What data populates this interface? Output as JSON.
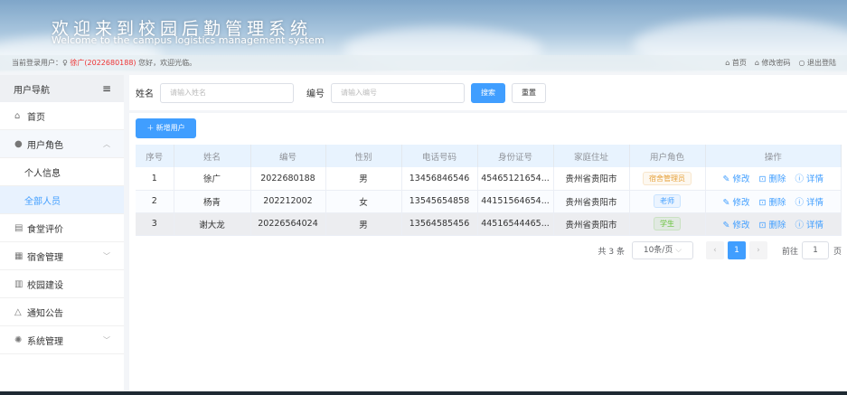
{
  "header": {
    "title_cn": "欢迎来到校园后勤管理系统",
    "title_en": "Welcome to the campus logistics management system",
    "login_prefix": "当前登录用户：",
    "user": "徐广(2022680188)",
    "greeting": "您好，欢迎光临。",
    "links": [
      {
        "icon": "home-icon",
        "label": "首页"
      },
      {
        "icon": "lock-icon",
        "label": "修改密码"
      },
      {
        "icon": "power-icon",
        "label": "退出登陆"
      }
    ]
  },
  "sidebar": {
    "title": "用户导航",
    "items": [
      {
        "icon": "home-icon",
        "label": "首页"
      },
      {
        "icon": "user-icon",
        "label": "用户角色",
        "expanded": true
      },
      {
        "label": "个人信息",
        "sub": true
      },
      {
        "label": "全部人员",
        "sub": true,
        "active": true
      },
      {
        "icon": "document-icon",
        "label": "食堂评价"
      },
      {
        "icon": "building-icon",
        "label": "宿舍管理",
        "has_children": true
      },
      {
        "icon": "office-icon",
        "label": "校园建设"
      },
      {
        "icon": "bell-icon",
        "label": "通知公告"
      },
      {
        "icon": "gear-icon",
        "label": "系统管理",
        "has_children": true
      }
    ]
  },
  "search": {
    "name_label": "姓名",
    "name_placeholder": "请输入姓名",
    "id_label": "编号",
    "id_placeholder": "请输入编号",
    "search_btn": "搜索",
    "reset_btn": "重置"
  },
  "add_btn": "＋ 新增用户",
  "table": {
    "headers": [
      "序号",
      "姓名",
      "编号",
      "性别",
      "电话号码",
      "身份证号",
      "家庭住址",
      "用户角色",
      "操作"
    ],
    "rows": [
      [
        "1",
        "徐广",
        "2022680188",
        "男",
        "13456846546",
        "45465121654...",
        "贵州省贵阳市",
        "宿舍管理员"
      ],
      [
        "2",
        "杨青",
        "202212002",
        "女",
        "13545654858",
        "44151564654...",
        "贵州省贵阳市",
        "老师"
      ],
      [
        "3",
        "谢大龙",
        "20226564024",
        "男",
        "13564585456",
        "44516544465...",
        "贵州省贵阳市",
        "学生"
      ]
    ],
    "actions": [
      "修改",
      "删除",
      "详情"
    ],
    "role_colors": {
      "宿舍管理员": "#e6a23c",
      "老师": "#409eff",
      "学生": "#67c23a"
    }
  },
  "pagination": {
    "total": "共 3 条",
    "page_size": "10条/页",
    "current": "1",
    "goto_label": "前往",
    "goto_value": "1",
    "page_suffix": "页"
  },
  "colors": {
    "accent": "#409eff",
    "username": "#e33333"
  }
}
